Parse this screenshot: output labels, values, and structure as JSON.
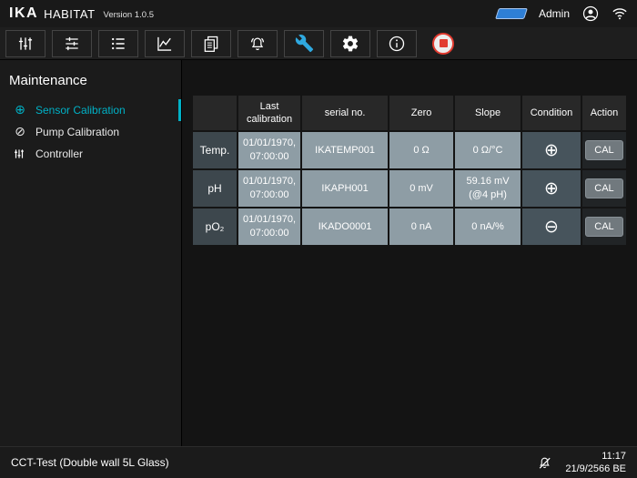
{
  "header": {
    "logo": "IKA",
    "app_name": "HABITAT",
    "version": "Version 1.0.5",
    "user": "Admin"
  },
  "toolbar": {
    "items": [
      {
        "name": "probe-levels"
      },
      {
        "name": "process-tune"
      },
      {
        "name": "list"
      },
      {
        "name": "trend-chart"
      },
      {
        "name": "reports"
      },
      {
        "name": "alarms"
      },
      {
        "name": "maintenance-wrench",
        "active": true
      },
      {
        "name": "settings-gear"
      },
      {
        "name": "info"
      },
      {
        "name": "record-stop"
      }
    ]
  },
  "sidebar": {
    "title": "Maintenance",
    "items": [
      {
        "label": "Sensor Calibration",
        "active": true
      },
      {
        "label": "Pump Calibration",
        "active": false
      },
      {
        "label": "Controller",
        "active": false
      }
    ]
  },
  "table": {
    "headers": [
      "",
      "Last calibration",
      "serial no.",
      "Zero",
      "Slope",
      "Condition",
      "Action"
    ],
    "rows": [
      {
        "label": "Temp.",
        "last_calibration": "01/01/1970, 07:00:00",
        "serial": "IKATEMP001",
        "zero": "0 Ω",
        "slope": "0 Ω/°C",
        "condition": "⊕",
        "action": "CAL"
      },
      {
        "label": "pH",
        "last_calibration": "01/01/1970, 07:00:00",
        "serial": "IKAPH001",
        "zero": "0 mV",
        "slope": "59.16 mV (@4 pH)",
        "condition": "⊕",
        "action": "CAL"
      },
      {
        "label": "pO₂",
        "last_calibration": "01/01/1970, 07:00:00",
        "serial": "IKADO0001",
        "zero": "0 nA",
        "slope": "0 nA/%",
        "condition": "⊖",
        "action": "CAL"
      }
    ]
  },
  "footer": {
    "vessel": "CCT-Test (Double wall 5L Glass)",
    "time": "11:17",
    "date": "21/9/2566 BE"
  },
  "colors": {
    "accent_teal": "#00b1c6",
    "accent_blue": "#2fa9e0",
    "record_red": "#e23b30",
    "cell_gray": "#8e9da5"
  }
}
